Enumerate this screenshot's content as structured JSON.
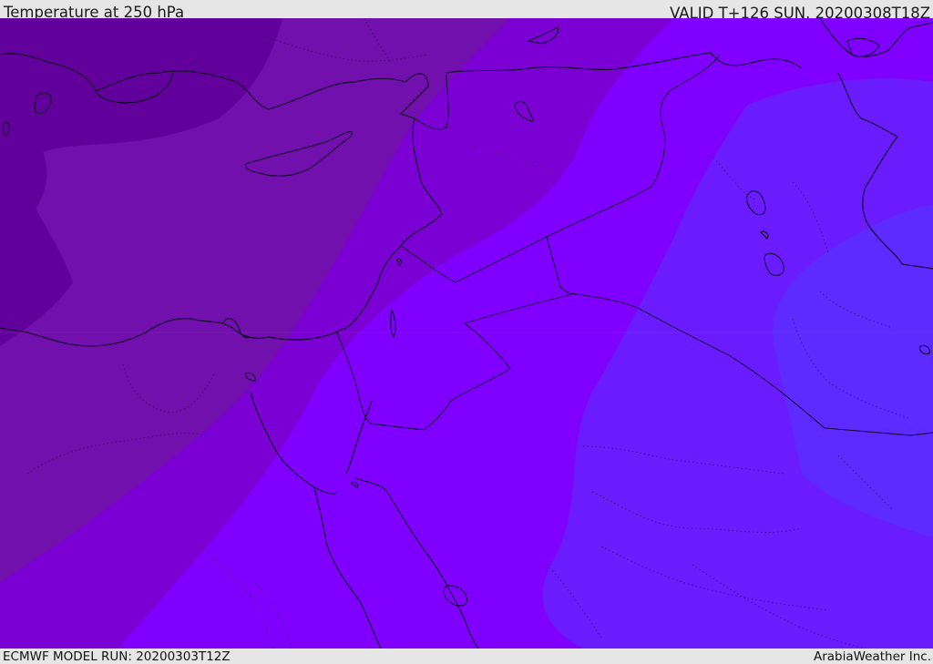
{
  "header": {
    "title": "Temperature at 250 hPa",
    "valid": "VALID T+126 SUN. 20200308T18Z"
  },
  "footer": {
    "model_run": "ECMWF MODEL RUN: 20200303T12Z",
    "credit": "ArabiaWeather Inc."
  },
  "palette": {
    "band_1": "#62009b",
    "band_2": "#7110ac",
    "band_3": "#7a00d3",
    "band_4": "#8000ff",
    "band_5": "#6a1cff",
    "band_6": "#5d2bff",
    "line": "#0d0021"
  }
}
